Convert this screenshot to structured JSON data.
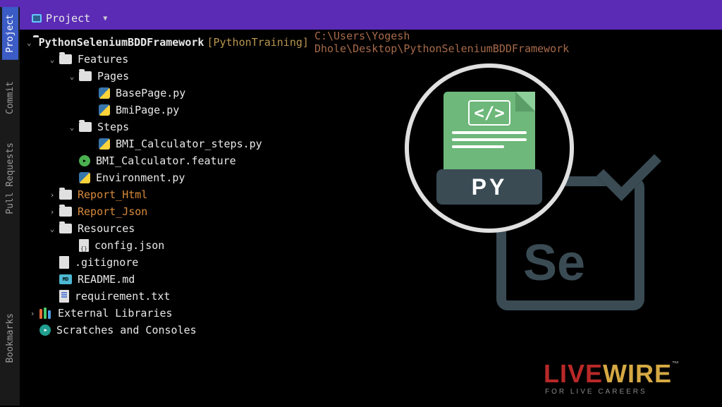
{
  "header": {
    "projectLabel": "Project"
  },
  "sidebarTabs": {
    "project": "Project",
    "commit": "Commit",
    "pullRequests": "Pull Requests",
    "bookmarks": "Bookmarks"
  },
  "tree": {
    "root": {
      "name": "PythonSeleniumBDDFramework",
      "runConfig": "[PythonTraining]",
      "path": "C:\\Users\\Yogesh Dhole\\Desktop\\PythonSeleniumBDDFramework"
    },
    "features": "Features",
    "pages": "Pages",
    "basePage": "BasePage.py",
    "bmiPage": "BmiPage.py",
    "steps": "Steps",
    "bmiCalcSteps": "BMI_Calculator_steps.py",
    "bmiCalcFeature": "BMI_Calculator.feature",
    "environment": "Environment.py",
    "reportHtml": "Report_Html",
    "reportJson": "Report_Json",
    "resources": "Resources",
    "configJson": "config.json",
    "gitignore": ".gitignore",
    "readme": "README.md",
    "requirement": "requirement.txt",
    "externalLibs": "External Libraries",
    "scratches": "Scratches and Consoles"
  },
  "graphic": {
    "codeTag": "</>",
    "pyLabel": "PY",
    "seLabel": "Se"
  },
  "watermark": {
    "live": "LIVE",
    "wire": "WIRE",
    "tm": "™",
    "tagline": "FOR LIVE CAREERS"
  }
}
